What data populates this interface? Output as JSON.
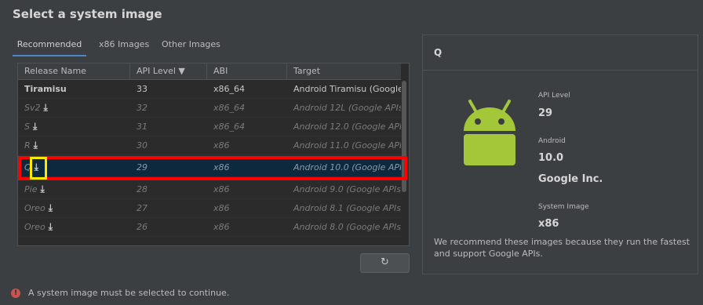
{
  "window": {
    "title": "Select a system image"
  },
  "tabs": [
    {
      "label": "Recommended"
    },
    {
      "label": "x86 Images"
    },
    {
      "label": "Other Images"
    }
  ],
  "table": {
    "columns": [
      "Release Name",
      "API Level ▼",
      "ABI",
      "Target"
    ],
    "rows": [
      {
        "name": "Tiramisu",
        "api": "33",
        "abi": "x86_64",
        "target": "Android Tiramisu (Google APIs)"
      },
      {
        "name": "Sv2",
        "api": "32",
        "abi": "x86_64",
        "target": "Android 12L (Google APIs)"
      },
      {
        "name": "S",
        "api": "31",
        "abi": "x86_64",
        "target": "Android 12.0 (Google APIs)"
      },
      {
        "name": "R",
        "api": "30",
        "abi": "x86",
        "target": "Android 11.0 (Google APIs)"
      },
      {
        "name": "Q",
        "api": "29",
        "abi": "x86",
        "target": "Android 10.0 (Google APIs)"
      },
      {
        "name": "Pie",
        "api": "28",
        "abi": "x86",
        "target": "Android 9.0 (Google APIs)"
      },
      {
        "name": "Oreo",
        "api": "27",
        "abi": "x86",
        "target": "Android 8.1 (Google APIs)"
      },
      {
        "name": "Oreo",
        "api": "26",
        "abi": "x86",
        "target": "Android 8.0 (Google APIs)"
      }
    ],
    "download_icon": "⤓"
  },
  "refresh": {
    "icon": "↻"
  },
  "error": {
    "icon": "!",
    "text": "A system image must be selected to continue."
  },
  "details": {
    "title": "Q",
    "api_level_label": "API Level",
    "api_level_value": "29",
    "android_label": "Android",
    "android_value": "10.0",
    "vendor": "Google Inc.",
    "system_image_label": "System Image",
    "system_image_value": "x86",
    "recommend_text": "We recommend these images because they run the fastest and support Google APIs."
  },
  "colors": {
    "background": "#3c3f41",
    "table_bg": "#2b2b2b",
    "selection": "#0d293e",
    "accent": "#4a88c7",
    "android_green": "#a4c639",
    "highlight_red": "#ff0000",
    "highlight_yellow": "#ffe800"
  }
}
